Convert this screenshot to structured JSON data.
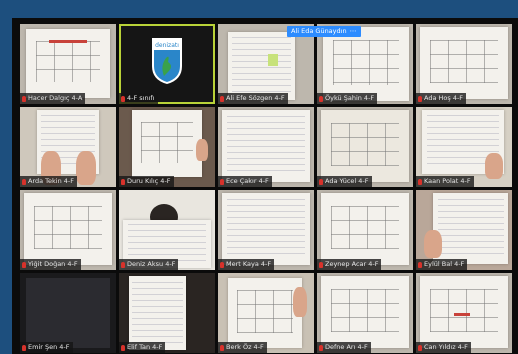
{
  "app": {
    "pinned_name": "Ali Eda Günaydın"
  },
  "logo_text": "denizatı",
  "tiles": [
    {
      "label": "Hacer Dalgıç 4-A"
    },
    {
      "label": "4-F sınıfı"
    },
    {
      "label": "Ali Efe Sözgen 4-F"
    },
    {
      "label": "Öykü Şahin 4-F"
    },
    {
      "label": "Ada Hoş 4-F"
    },
    {
      "label": "Arda Tekin 4-F"
    },
    {
      "label": "Duru Kılıç 4-F"
    },
    {
      "label": "Ece Çakır 4-F"
    },
    {
      "label": "Ada Yücel 4-F"
    },
    {
      "label": "Kaan Polat 4-F"
    },
    {
      "label": "Yiğit Doğan 4-F"
    },
    {
      "label": "Deniz Aksu 4-F"
    },
    {
      "label": "Mert Kaya 4-F"
    },
    {
      "label": "Zeynep Acar 4-F"
    },
    {
      "label": "Eylül Bal 4-F"
    },
    {
      "label": "Emir Şen 4-F"
    },
    {
      "label": "Elif Tan 4-F"
    },
    {
      "label": "Berk Öz 4-F"
    },
    {
      "label": "Defne Arı 4-F"
    },
    {
      "label": "Can Yıldız 4-F"
    }
  ]
}
